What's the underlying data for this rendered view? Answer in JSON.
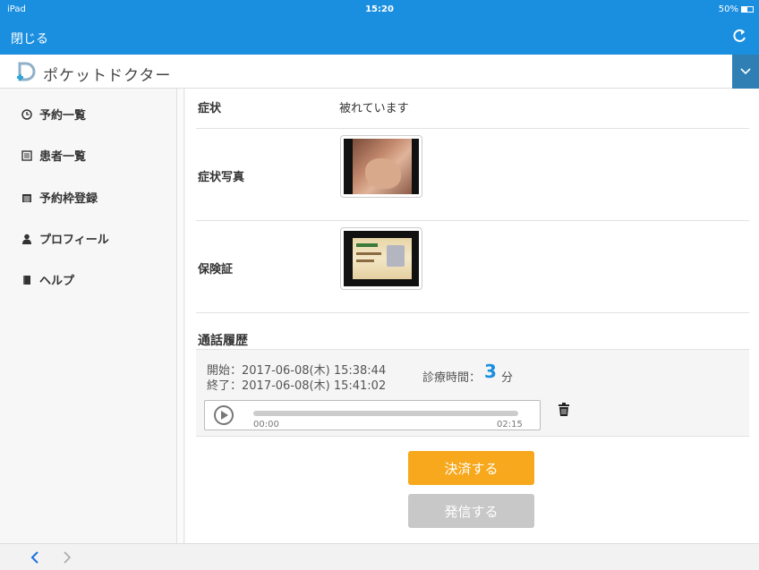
{
  "status_bar": {
    "device": "iPad",
    "time": "15:20",
    "battery": "50%"
  },
  "topbar": {
    "close_label": "閉じる"
  },
  "header": {
    "app_title": "ポケットドクター"
  },
  "sidebar": {
    "items": [
      {
        "label": "予約一覧",
        "icon": "clock-icon"
      },
      {
        "label": "患者一覧",
        "icon": "list-icon"
      },
      {
        "label": "予約枠登録",
        "icon": "calendar-icon"
      },
      {
        "label": "プロフィール",
        "icon": "person-icon"
      },
      {
        "label": "ヘルプ",
        "icon": "book-icon"
      }
    ]
  },
  "main": {
    "symptom_label": "症状",
    "symptom_value": "被れています",
    "symptom_photo_label": "症状写真",
    "insurance_label": "保険証",
    "call_history_title": "通話履歴",
    "call_start": "開始：2017-06-08(木) 15:38:44",
    "call_end": "終了：2017-06-08(木) 15:41:02",
    "duration_label": "診療時間：",
    "duration_value": "3",
    "duration_unit": "分",
    "audio": {
      "start_time": "00:00",
      "end_time": "02:15"
    },
    "pay_button": "決済する",
    "call_button": "発信する"
  },
  "colors": {
    "primary": "#1a8fe0",
    "accent": "#f7a81c",
    "disabled": "#c8c8c8"
  }
}
